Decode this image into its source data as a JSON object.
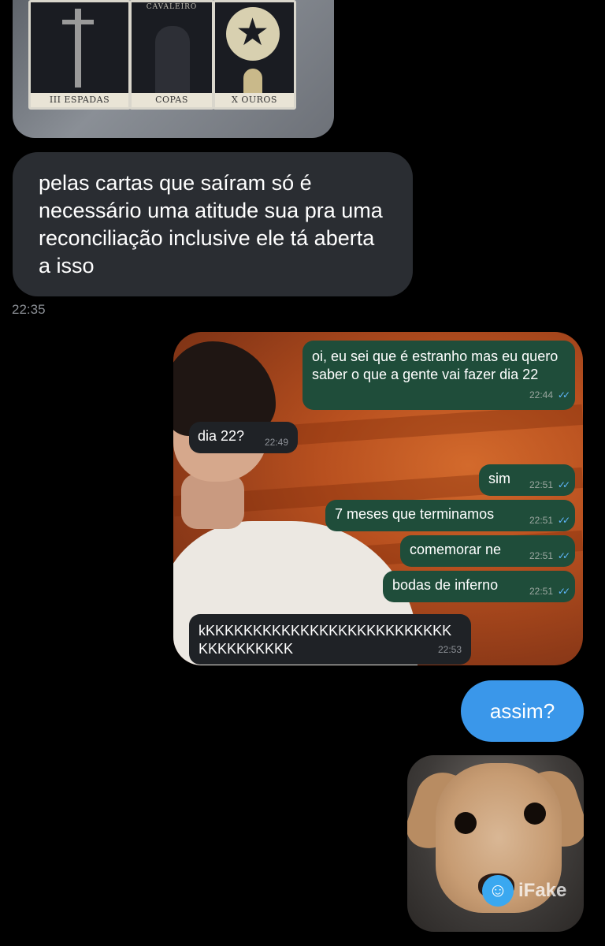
{
  "tarot": {
    "cards": [
      {
        "top": "",
        "caption": "III ESPADAS"
      },
      {
        "top": "CAVALEIRO",
        "caption": "COPAS"
      },
      {
        "top": "",
        "caption": "X OUROS"
      }
    ]
  },
  "received": {
    "text": "pelas cartas que saíram só é necessário uma atitude sua pra uma reconciliação inclusive ele tá aberta a isso",
    "time": "22:35"
  },
  "screenshot": {
    "messages": [
      {
        "dir": "out",
        "text": "oi, eu sei que é estranho mas eu quero saber o que a gente vai fazer dia 22",
        "time": "22:44"
      },
      {
        "dir": "in",
        "text": "dia 22?",
        "time": "22:49"
      },
      {
        "dir": "out",
        "text": "sim",
        "time": "22:51"
      },
      {
        "dir": "out",
        "text": "7 meses que terminamos",
        "time": "22:51"
      },
      {
        "dir": "out",
        "text": "comemorar ne",
        "time": "22:51"
      },
      {
        "dir": "out",
        "text": "bodas de inferno",
        "time": "22:51"
      },
      {
        "dir": "in",
        "text": "kKKKKKKKKKKKKKKKKKKKKKKKKKK KKKKKKKKKK",
        "time": "22:53"
      }
    ]
  },
  "sent": {
    "text": "assim?"
  },
  "puppy": {
    "watermark": "iFake"
  },
  "colors": {
    "blue_bubble": "#3a97ea",
    "gray_bubble": "#2a2d32",
    "ws_out": "#1f4d3a"
  }
}
